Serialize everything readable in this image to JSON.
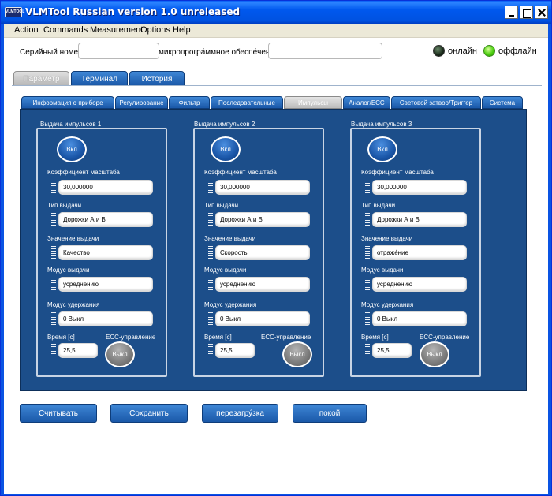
{
  "window": {
    "title": "VLMTool  Russian version 1.0 unreleased",
    "icon_text": "VLMTOOL"
  },
  "menu": [
    "Action",
    "Commands",
    "Measurement",
    "Options",
    "Help"
  ],
  "serial": {
    "serial_label": "Серийный номер",
    "serial_value": "",
    "firmware_label": "микропрогра́ммное обеспе́чение",
    "firmware_value": "",
    "online_label": "онлайн",
    "offline_label": "оффлайн"
  },
  "main_tabs": [
    {
      "label": "Параметр",
      "active": true
    },
    {
      "label": "Терминал",
      "active": false
    },
    {
      "label": "История",
      "active": false
    }
  ],
  "sub_tabs": [
    {
      "label": "Информация о приборе",
      "active": false
    },
    {
      "label": "Регулирование",
      "active": false
    },
    {
      "label": "Фильтр",
      "active": false
    },
    {
      "label": "Последовательные",
      "active": false
    },
    {
      "label": "Импульсы",
      "active": true
    },
    {
      "label": "Аналог/ЕСС",
      "active": false
    },
    {
      "label": "Световой затвор/Триггер",
      "active": false
    },
    {
      "label": "Система",
      "active": false
    }
  ],
  "pulse_outputs": [
    {
      "title": "Выдача импульсов 1",
      "enable_button": "Вкл",
      "scale_label": "Коэффициент масштаба",
      "scale_value": "30,000000",
      "type_label": "Тип выдачи",
      "type_value": "Дорожки А и В",
      "value_label": "Значение выдачи",
      "value_value": "Качество",
      "mode_label": "Модус выдачи",
      "mode_value": "усреднению",
      "hold_label": "Модус удержания",
      "hold_value": "0 Выкл",
      "time_label": "Время [с]",
      "time_value": "25,5",
      "ecc_label": "ЕСС-управление",
      "ecc_button": "Выкл"
    },
    {
      "title": "Выдача импульсов 2",
      "enable_button": "Вкл",
      "scale_label": "Коэффициент масштаба",
      "scale_value": "30,000000",
      "type_label": "Тип выдачи",
      "type_value": "Дорожки А и В",
      "value_label": "Значение выдачи",
      "value_value": "Скорость",
      "mode_label": "Модус выдачи",
      "mode_value": "усреднению",
      "hold_label": "Модус удержания",
      "hold_value": "0 Выкл",
      "time_label": "Время [с]",
      "time_value": "25,5",
      "ecc_label": "ЕСС-управление",
      "ecc_button": "Выкл"
    },
    {
      "title": "Выдача импульсов 3",
      "enable_button": "Вкл",
      "scale_label": "Коэффициент масштаба",
      "scale_value": "30,000000",
      "type_label": "Тип выдачи",
      "type_value": "Дорожки А и В",
      "value_label": "Значение выдачи",
      "value_value": "отраже́ние",
      "mode_label": "Модус выдачи",
      "mode_value": "усреднению",
      "hold_label": "Модус удержания",
      "hold_value": "0 Выкл",
      "time_label": "Время [с]",
      "time_value": "25,5",
      "ecc_label": "ЕСС-управление",
      "ecc_button": "Выкл"
    }
  ],
  "bottom_buttons": {
    "read": "Считывать",
    "save": "Сохранить",
    "reboot": "перезагру́зка",
    "rest": "покой"
  },
  "colors": {
    "panel_bg": "#1c4e8a",
    "button_blue": "#1a58a8",
    "led_online": "#1a2a1a",
    "led_offline": "#4ed012"
  }
}
